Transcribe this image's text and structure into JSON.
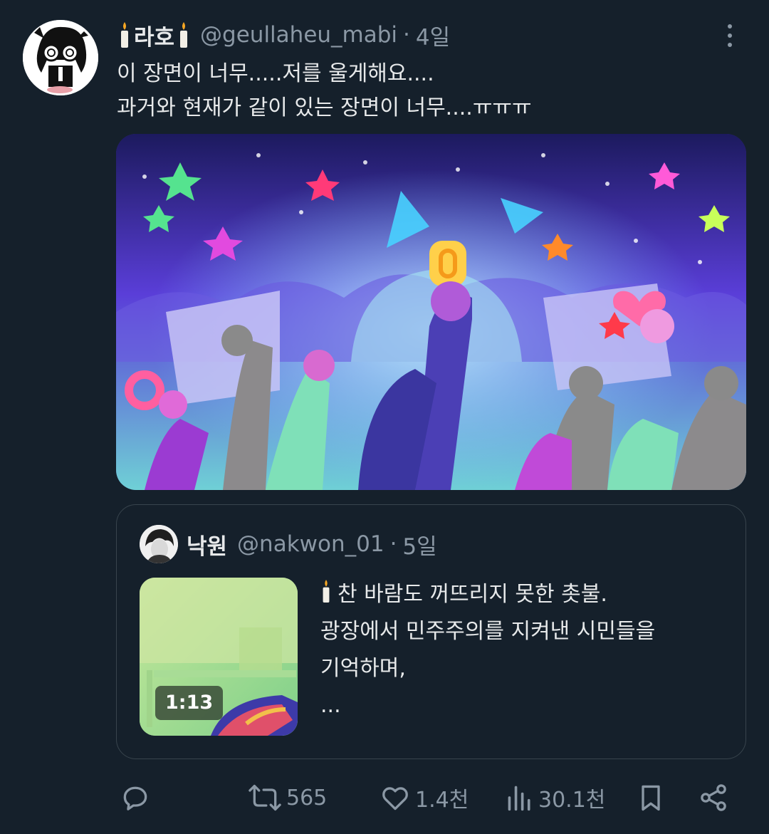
{
  "tweet": {
    "display_name": "라호",
    "handle": "@geullaheu_mabi",
    "time": "4일",
    "text_lines": [
      "이 장면이 너무.....저를 울게해요....",
      "과거와 현재가 같이 있는 장면이 너무....ㅠㅠㅠ"
    ],
    "candle_icon": "candle-emoji",
    "more_icon": "more-vertical-icon"
  },
  "quoted": {
    "display_name": "낙원",
    "handle": "@nakwon_01",
    "time": "5일",
    "video_duration": "1:13",
    "text_lines": [
      "찬 바람도 꺼뜨리지 못한  촛불.",
      "광장에서 민주주의를 지켜낸 시민들을",
      "기억하며,",
      "..."
    ]
  },
  "actions": {
    "reply_icon": "reply-icon",
    "repost_icon": "repost-icon",
    "repost_count": "565",
    "like_icon": "heart-icon",
    "like_count": "1.4천",
    "views_icon": "views-icon",
    "views_count": "30.1천",
    "bookmark_icon": "bookmark-icon",
    "share_icon": "share-icon"
  },
  "colors": {
    "background": "#15202b",
    "text": "#e7e9ea",
    "secondary": "#8b98a5",
    "border": "#38444d"
  }
}
